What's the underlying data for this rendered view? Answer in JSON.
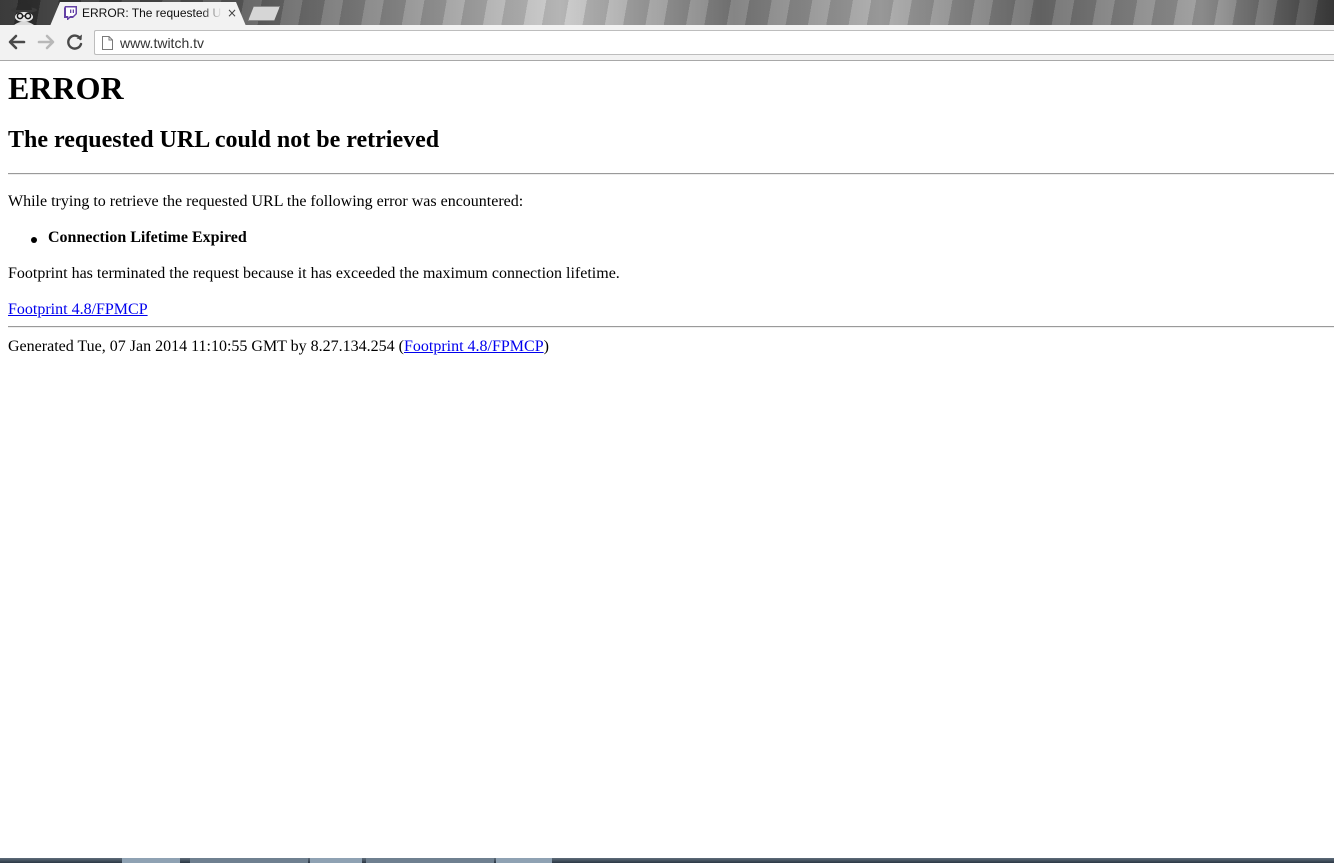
{
  "browser": {
    "tab_title": "ERROR: The requested URL could not be retrieved",
    "tab_close_glyph": "×",
    "url": "www.twitch.tv",
    "icons": {
      "profile": "incognito-spy-icon",
      "favicon": "twitch-favicon-icon",
      "back": "back-arrow-icon",
      "forward": "forward-arrow-icon",
      "reload": "reload-icon",
      "page": "page-icon"
    },
    "colors": {
      "twitch_purple": "#6441a5"
    }
  },
  "page": {
    "heading": "ERROR",
    "subheading": "The requested URL could not be retrieved",
    "intro": "While trying to retrieve the requested URL the following error was encountered:",
    "error_item": "Connection Lifetime Expired",
    "explanation": "Footprint has terminated the request because it has exceeded the maximum connection lifetime.",
    "signature_link": "Footprint 4.8/FPMCP",
    "footer": {
      "prefix": "Generated Tue, 07 Jan 2014 11:10:55 GMT by 8.27.134.254 (",
      "link": "Footprint 4.8/FPMCP",
      "suffix": ")"
    },
    "link_color": "#0000ee"
  }
}
